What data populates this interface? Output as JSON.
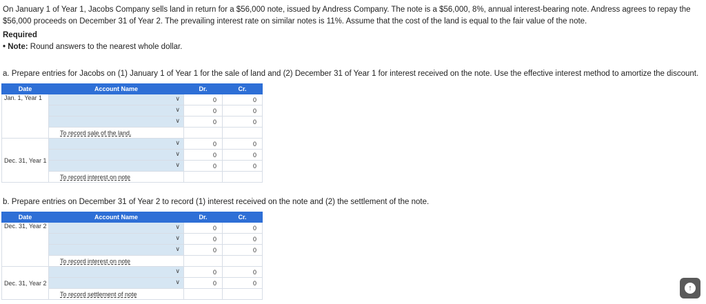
{
  "intro": "On January 1 of Year 1, Jacobs Company sells land in return for a $56,000 note, issued by Andress Company. The note is a $56,000, 8%, annual interest-bearing note. Andress agrees to repay the $56,000 proceeds on December 31 of Year 2. The prevailing interest rate on similar notes is 11%. Assume that the cost of the land is equal to the fair value of the note.",
  "required_label": "Required",
  "note_prefix": "• Note:",
  "note_text": " Round answers to the nearest whole dollar.",
  "part_a": "a. Prepare entries for Jacobs on (1) January 1 of Year 1 for the sale of land and (2) December 31 of Year 1 for interest received on the note. Use the effective interest method to amortize the discount.",
  "part_b": "b. Prepare entries on December 31 of Year 2 to record (1) interest received on the note and (2) the settlement of the note.",
  "headers": {
    "date": "Date",
    "account": "Account Name",
    "dr": "Dr.",
    "cr": "Cr."
  },
  "table_a": {
    "entry1": {
      "date": "Jan. 1, Year 1",
      "rows": [
        {
          "dr": "0",
          "cr": "0"
        },
        {
          "dr": "0",
          "cr": "0"
        },
        {
          "dr": "0",
          "cr": "0"
        }
      ],
      "memo": "To record sale of the land."
    },
    "entry2": {
      "date": "Dec. 31, Year 1",
      "rows": [
        {
          "dr": "0",
          "cr": "0"
        },
        {
          "dr": "0",
          "cr": "0"
        },
        {
          "dr": "0",
          "cr": "0"
        }
      ],
      "memo": "To record interest on note"
    }
  },
  "table_b": {
    "entry1": {
      "date": "Dec. 31, Year 2",
      "rows": [
        {
          "dr": "0",
          "cr": "0"
        },
        {
          "dr": "0",
          "cr": "0"
        },
        {
          "dr": "0",
          "cr": "0"
        }
      ],
      "memo": "To record interest on note"
    },
    "entry2": {
      "date": "Dec. 31, Year 2",
      "rows": [
        {
          "dr": "0",
          "cr": "0"
        },
        {
          "dr": "0",
          "cr": "0"
        }
      ],
      "memo": "To record settlement of note"
    }
  },
  "icons": {
    "dropdown": "chevron-down-icon",
    "scroll_top": "arrow-up-icon"
  }
}
